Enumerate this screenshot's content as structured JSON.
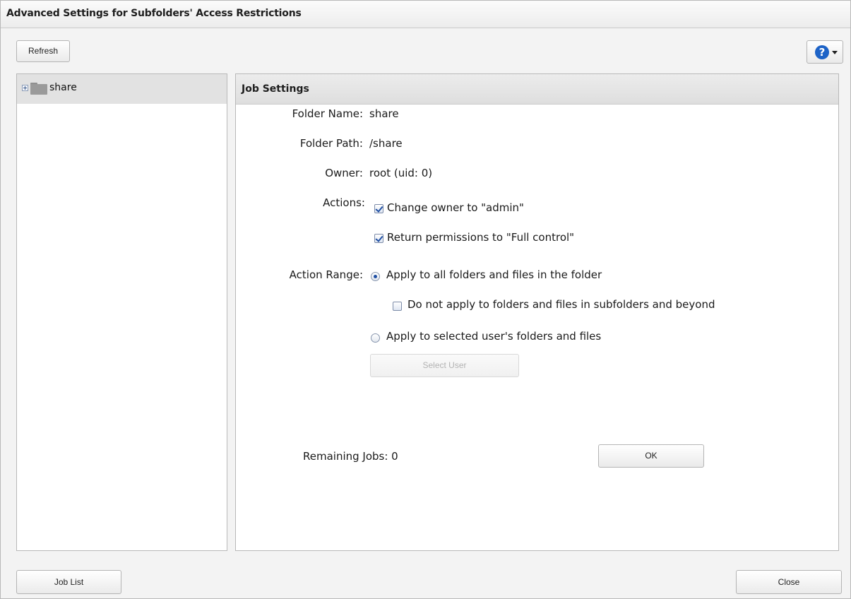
{
  "dialog": {
    "title": "Advanced Settings for Subfolders' Access Restrictions"
  },
  "toolbar": {
    "refresh_label": "Refresh",
    "help_icon": "question-mark-icon"
  },
  "tree": {
    "items": [
      {
        "label": "share",
        "icon": "folder-icon",
        "expander": "expand-plus-icon"
      }
    ]
  },
  "job_settings": {
    "header": "Job Settings",
    "folder_name_label": "Folder Name:",
    "folder_name_value": "share",
    "folder_path_label": "Folder Path:",
    "folder_path_value": "/share",
    "owner_label": "Owner:",
    "owner_value": "root (uid: 0)",
    "actions_label": "Actions:",
    "actions": [
      {
        "label": "Change owner to \"admin\"",
        "checked": true
      },
      {
        "label": "Return permissions to \"Full control\"",
        "checked": true
      }
    ],
    "action_range_label": "Action Range:",
    "range_options": [
      {
        "label": "Apply to all folders and files in the folder",
        "selected": true
      },
      {
        "label": "Apply to selected user's folders and files",
        "selected": false
      }
    ],
    "sub_option": {
      "label": "Do not apply to folders and files in subfolders and beyond",
      "checked": false
    },
    "select_user_label": "Select User",
    "remaining_jobs_label": "Remaining Jobs: 0",
    "ok_label": "OK"
  },
  "footer": {
    "job_list_label": "Job List",
    "close_label": "Close"
  },
  "colors": {
    "accent": "#1d63c7",
    "check": "#1f4fa3",
    "tree_selected": "#e2e2e2"
  }
}
